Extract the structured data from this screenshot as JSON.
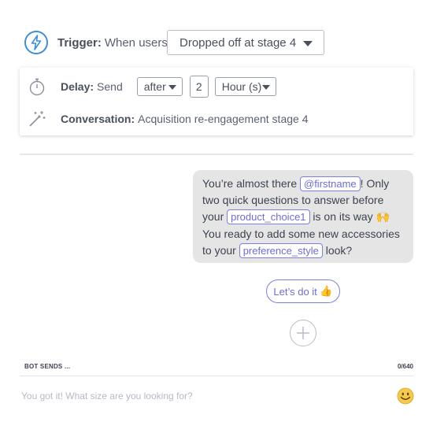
{
  "trigger": {
    "label": "Trigger:",
    "text": "When users",
    "selected": "Dropped off at stage 4"
  },
  "delay": {
    "label": "Delay:",
    "text": "Send",
    "timing": "after",
    "amount": "2",
    "unit": "Hour (s)"
  },
  "conversation": {
    "label": "Conversation:",
    "name": "Acquisition re-engagement stage 4"
  },
  "message": {
    "part1": "You’re almost there ",
    "var1": "@firstname",
    "part2": "! Only two quick questions to answer before your ",
    "var2": "product_choice1",
    "part3": " is on its way ",
    "emoji1": "🙌",
    "part4": " You ready to add some new accessories to your ",
    "var3": "preference_style",
    "part5": " look?"
  },
  "quick_reply": {
    "label": "Let’s do it",
    "emoji": "👍"
  },
  "composer": {
    "header": "BOT SENDS ...",
    "counter": "0/640",
    "placeholder": "You got it! What size are you looking for?"
  },
  "colors": {
    "accent_blue": "#3c8fd8",
    "variable_purple": "#6e6cd8",
    "bubble_bg": "#e5e5e6",
    "emoji_yellow": "#f7c948"
  },
  "icons": [
    "lightning-bolt-icon",
    "stopwatch-icon",
    "magic-wand-icon",
    "plus-icon",
    "smiley-icon"
  ]
}
